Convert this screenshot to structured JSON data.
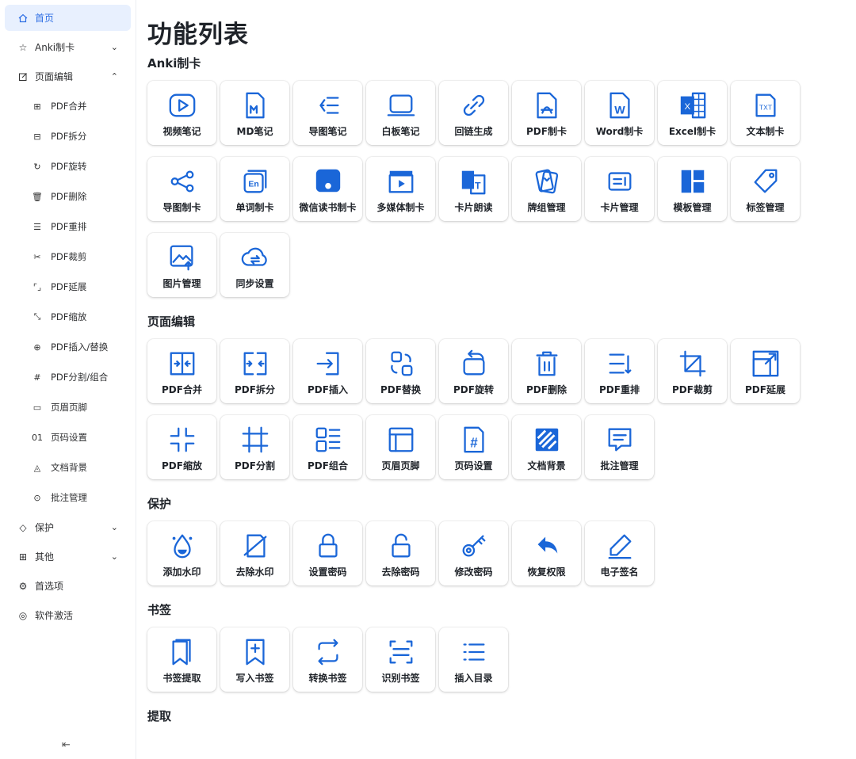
{
  "sidebar": {
    "items": [
      {
        "label": "首页",
        "icon": "home-icon"
      },
      {
        "label": "Anki制卡",
        "icon": "star-icon"
      },
      {
        "label": "页面编辑",
        "icon": "edit-icon"
      }
    ],
    "sub_items": [
      {
        "label": "PDF合并",
        "icon": "merge-icon"
      },
      {
        "label": "PDF拆分",
        "icon": "split-icon"
      },
      {
        "label": "PDF旋转",
        "icon": "rotate-icon"
      },
      {
        "label": "PDF删除",
        "icon": "trash-icon"
      },
      {
        "label": "PDF重排",
        "icon": "list-icon"
      },
      {
        "label": "PDF裁剪",
        "icon": "scissors-icon"
      },
      {
        "label": "PDF延展",
        "icon": "expand-icon"
      },
      {
        "label": "PDF缩放",
        "icon": "shrink-icon"
      },
      {
        "label": "PDF插入/替换",
        "icon": "insert-icon"
      },
      {
        "label": "PDF分割/组合",
        "icon": "hash-icon"
      },
      {
        "label": "页眉页脚",
        "icon": "header-footer-icon"
      },
      {
        "label": "页码设置",
        "icon": "page-number-icon"
      },
      {
        "label": "文档背景",
        "icon": "background-icon"
      },
      {
        "label": "批注管理",
        "icon": "comment-icon"
      }
    ],
    "bottom_items": [
      {
        "label": "保护",
        "icon": "shield-icon"
      },
      {
        "label": "其他",
        "icon": "grid-icon"
      },
      {
        "label": "首选项",
        "icon": "gear-icon"
      },
      {
        "label": "软件激活",
        "icon": "badge-icon"
      }
    ],
    "collapse_glyph": "⇤"
  },
  "main": {
    "title": "功能列表",
    "sections": [
      {
        "title": "Anki制卡",
        "tiles": [
          "视频笔记",
          "MD笔记",
          "导图笔记",
          "白板笔记",
          "回链生成",
          "PDF制卡",
          "Word制卡",
          "Excel制卡",
          "文本制卡",
          "导图制卡",
          "单词制卡",
          "微信读书制卡",
          "多媒体制卡",
          "卡片朗读",
          "牌组管理",
          "卡片管理",
          "模板管理",
          "标签管理",
          "图片管理",
          "同步设置"
        ]
      },
      {
        "title": "页面编辑",
        "tiles": [
          "PDF合并",
          "PDF拆分",
          "PDF插入",
          "PDF替换",
          "PDF旋转",
          "PDF删除",
          "PDF重排",
          "PDF裁剪",
          "PDF延展",
          "PDF缩放",
          "PDF分割",
          "PDF组合",
          "页眉页脚",
          "页码设置",
          "文档背景",
          "批注管理"
        ]
      },
      {
        "title": "保护",
        "tiles": [
          "添加水印",
          "去除水印",
          "设置密码",
          "去除密码",
          "修改密码",
          "恢复权限",
          "电子签名"
        ]
      },
      {
        "title": "书签",
        "tiles": [
          "书签提取",
          "写入书签",
          "转换书签",
          "识别书签",
          "插入目录"
        ]
      },
      {
        "title": "提取",
        "tiles": []
      }
    ]
  },
  "colors": {
    "accent": "#2f6fe4",
    "icon_blue": "#1a66d8",
    "active_bg": "#e8f0fe"
  }
}
